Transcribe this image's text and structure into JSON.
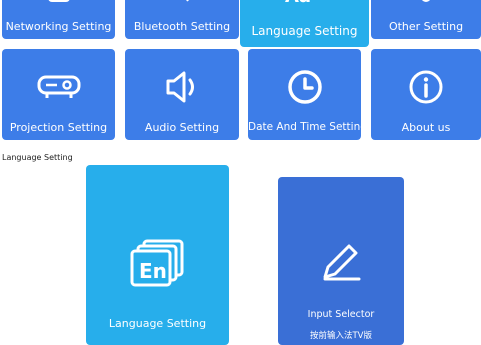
{
  "colors": {
    "tile": "#3d7de8",
    "tile_active": "#27aeeb",
    "tile_dark": "#3a6fd6"
  },
  "top_row": [
    {
      "label": "Networking Setting",
      "icon": "network-icon"
    },
    {
      "label": "Bluetooth Setting",
      "icon": "bluetooth-icon"
    },
    {
      "label": "Language Setting",
      "icon": "language-icon"
    },
    {
      "label": "Other Setting",
      "icon": "other-icon"
    }
  ],
  "bottom_row": [
    {
      "label": "Projection Setting",
      "icon": "projector-icon"
    },
    {
      "label": "Audio Setting",
      "icon": "speaker-icon"
    },
    {
      "label": "Date And Time Setting",
      "icon": "clock-icon"
    },
    {
      "label": "About us",
      "icon": "info-icon"
    }
  ],
  "section_title": "Language Setting",
  "language_card": {
    "label": "Language Setting",
    "icon": "language-en-icon"
  },
  "input_card": {
    "label": "Input Selector",
    "sublabel": "按前输入法TV版",
    "icon": "pen-icon"
  }
}
